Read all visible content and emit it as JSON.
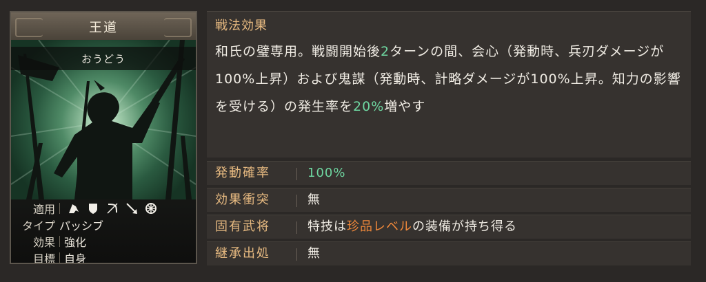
{
  "card": {
    "title": "王道",
    "kana": "おうどう",
    "info": {
      "applies_label": "適用",
      "applies_icons": [
        "cavalry-icon",
        "shield-icon",
        "bow-icon",
        "spear-icon",
        "wheel-icon"
      ],
      "type_label": "タイプ",
      "type_value": "パッシブ",
      "effect_label": "効果",
      "effect_value": "強化",
      "target_label": "目標",
      "target_value": "自身"
    }
  },
  "effect": {
    "title": "戦法効果",
    "text_1": "和氏の璧専用。戦闘開始後",
    "text_turns": "2",
    "text_2": "ターンの間、会心（発動時、兵刃ダメージが100%上昇）および鬼謀（発動時、計略ダメージが100%上昇。知力の影響を受ける）の発生率を",
    "text_rate": "20%",
    "text_3": "増やす"
  },
  "attributes": [
    {
      "label": "発動確率",
      "value": "100%"
    },
    {
      "label": "効果衝突",
      "value": "無"
    },
    {
      "label": "固有武将",
      "value_pre": "特技は",
      "value_highlight": "珍品レベル",
      "value_post": "の装備が持ち得る"
    },
    {
      "label": "継承出処",
      "value": "無"
    }
  ],
  "colors": {
    "accent_label": "#e6b980",
    "green_value": "#6ed6a0",
    "orange_value": "#f0883a"
  }
}
